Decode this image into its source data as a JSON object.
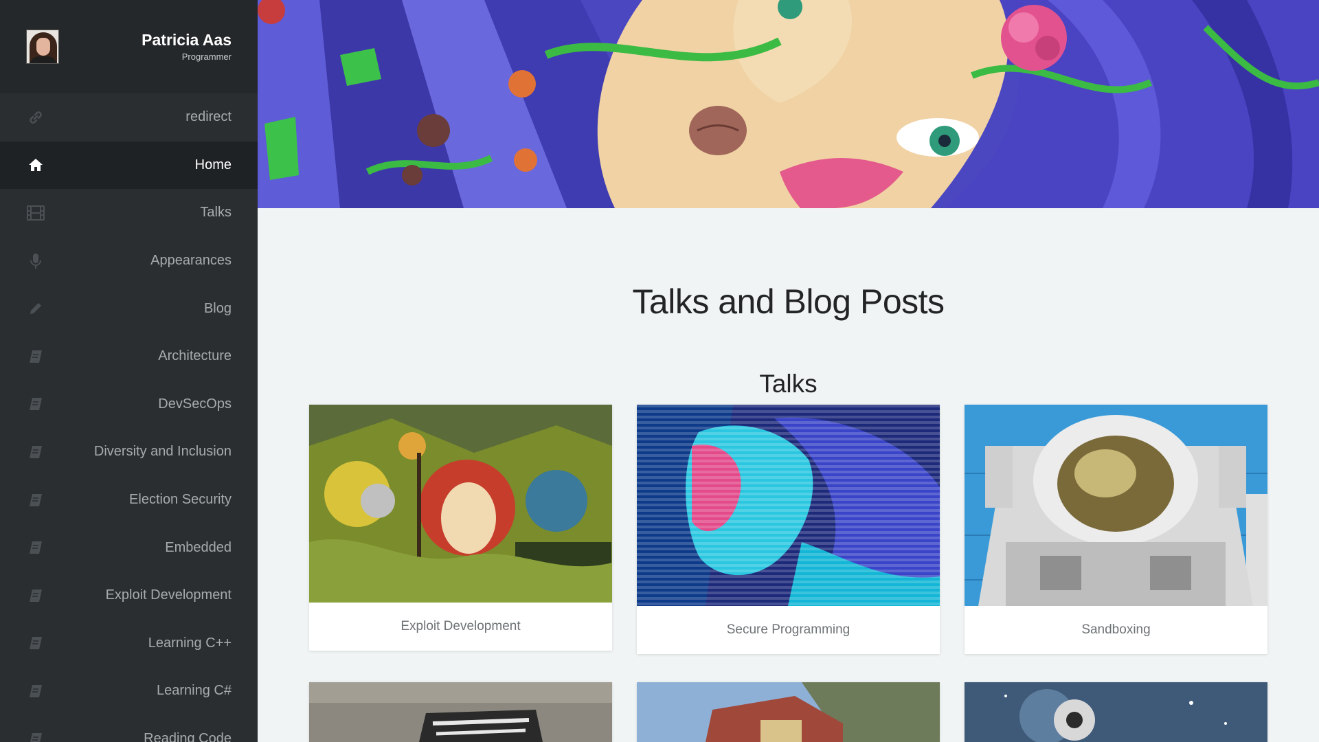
{
  "profile": {
    "name": "Patricia Aas",
    "role": "Programmer"
  },
  "nav": {
    "items": [
      {
        "label": "redirect",
        "icon": "link-icon"
      },
      {
        "label": "Home",
        "icon": "home-icon",
        "active": true
      },
      {
        "label": "Talks",
        "icon": "film-icon"
      },
      {
        "label": "Appearances",
        "icon": "microphone-icon"
      },
      {
        "label": "Blog",
        "icon": "pencil-icon"
      },
      {
        "label": "Architecture",
        "icon": "book-icon"
      },
      {
        "label": "DevSecOps",
        "icon": "book-icon"
      },
      {
        "label": "Diversity and Inclusion",
        "icon": "book-icon"
      },
      {
        "label": "Election Security",
        "icon": "book-icon"
      },
      {
        "label": "Embedded",
        "icon": "book-icon"
      },
      {
        "label": "Exploit Development",
        "icon": "book-icon"
      },
      {
        "label": "Learning C++",
        "icon": "book-icon"
      },
      {
        "label": "Learning C#",
        "icon": "book-icon"
      },
      {
        "label": "Reading Code",
        "icon": "book-icon"
      }
    ]
  },
  "main": {
    "title": "Talks and Blog Posts",
    "section_title": "Talks",
    "cards": [
      {
        "caption": "Exploit Development"
      },
      {
        "caption": "Secure Programming"
      },
      {
        "caption": "Sandboxing"
      }
    ]
  },
  "colors": {
    "sidebar_bg": "#2b2e30",
    "sidebar_active_bg": "#1f2224",
    "page_bg": "#f1f4f4",
    "hero_accent": "#5a5ad0"
  }
}
